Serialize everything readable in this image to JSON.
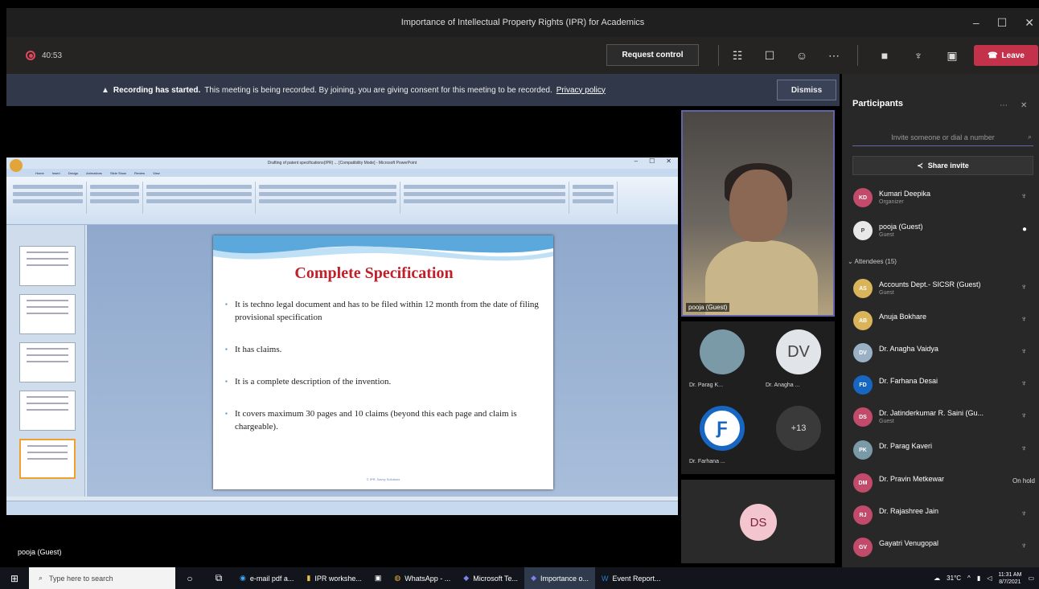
{
  "window": {
    "title": "Importance of Intellectual Property Rights (IPR) for Academics",
    "controls": [
      "–",
      "☐",
      "✕"
    ]
  },
  "toolbar": {
    "timer": "40:53",
    "request_control": "Request control",
    "leave_label": "Leave",
    "icons": [
      "people-icon",
      "chat-icon",
      "reactions-icon",
      "more-icon",
      "camera-off-icon",
      "mic-off-icon",
      "share-icon"
    ]
  },
  "banner": {
    "bold": "Recording has started.",
    "text": "This meeting is being recorded. By joining, you are giving consent for this meeting to be recorded.",
    "link": "Privacy policy",
    "dismiss": "Dismiss"
  },
  "presentation": {
    "window_title": "Drafting of patent specifications(IPR) ... [Compatibility Mode] - Microsoft PowerPoint",
    "tabs": [
      "Home",
      "Insert",
      "Design",
      "Animations",
      "Slide Show",
      "Review",
      "View"
    ],
    "slide_title": "Complete Specification",
    "bullets": [
      "It is techno legal document  and has to be filed within 12 month from the date of filing provisional specification",
      "It has claims.",
      "It is a complete description of the invention.",
      "It  covers maximum 30 pages and 10 claims (beyond this each page and claim is chargeable)."
    ],
    "footer": "© IPR, Savvy Solutions"
  },
  "video": {
    "self_label": "pooja (Guest)",
    "tiles": [
      {
        "name": "Dr. Parag K...",
        "initials": "",
        "color": "#7a9aa8"
      },
      {
        "name": "Dr. Anagha ...",
        "initials": "DV",
        "color": "#e1e4e8"
      },
      {
        "name": "Dr. Farhana ...",
        "initials": "",
        "color": "#1767c2"
      },
      {
        "name": "",
        "initials": "+13",
        "color": "#3a3a3a"
      }
    ],
    "ds_initials": "DS",
    "presenter": "pooja (Guest)"
  },
  "participants": {
    "title": "Participants",
    "invite_placeholder": "Invite someone or dial a number",
    "share_invite": "Share invite",
    "attendees_header": "Attendees (15)",
    "list": [
      {
        "initials": "KD",
        "name": "Kumari Deepika",
        "role": "Organizer",
        "color": "#c24b6b",
        "status": "mic"
      },
      {
        "initials": "P",
        "name": "pooja (Guest)",
        "role": "Guest",
        "color": "#e8e8e8",
        "status": "mic-on"
      },
      {
        "initials": "AS",
        "name": "Accounts Dept.- SICSR (Guest)",
        "role": "Guest",
        "color": "#d9b45a",
        "status": "mic"
      },
      {
        "initials": "AB",
        "name": "Anuja Bokhare",
        "role": "",
        "color": "#d9b45a",
        "status": "mic"
      },
      {
        "initials": "DV",
        "name": "Dr. Anagha Vaidya",
        "role": "",
        "color": "#9ab0c4",
        "status": "mic"
      },
      {
        "initials": "FD",
        "name": "Dr. Farhana Desai",
        "role": "",
        "color": "#1767c2",
        "status": "mic"
      },
      {
        "initials": "DS",
        "name": "Dr. Jatinderkumar R. Saini (Gu...",
        "role": "Guest",
        "color": "#c24b6b",
        "status": "mic"
      },
      {
        "initials": "PK",
        "name": "Dr. Parag Kaveri",
        "role": "",
        "color": "#7a9aa8",
        "status": "mic"
      },
      {
        "initials": "DM",
        "name": "Dr. Pravin Metkewar",
        "role": "",
        "color": "#c24b6b",
        "status": "On hold"
      },
      {
        "initials": "RJ",
        "name": "Dr. Rajashree Jain",
        "role": "",
        "color": "#c24b6b",
        "status": "mic"
      },
      {
        "initials": "GV",
        "name": "Gayatri Venugopal",
        "role": "",
        "color": "#c24b6b",
        "status": "mic"
      }
    ]
  },
  "taskbar": {
    "search_placeholder": "Type here to search",
    "apps": [
      "e-mail pdf a...",
      "IPR workshe...",
      "",
      "WhatsApp - ...",
      "Microsoft Te...",
      "Importance o...",
      "Event Report..."
    ],
    "weather": "31°C",
    "time": "11:31 AM",
    "date": "8/7/2021"
  }
}
